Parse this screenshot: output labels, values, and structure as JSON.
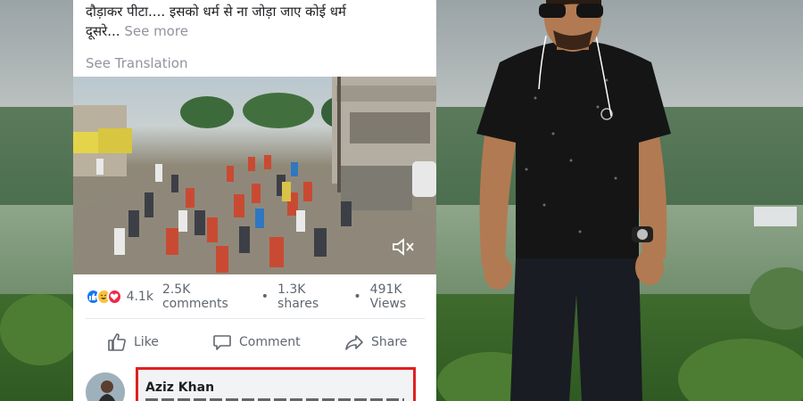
{
  "post": {
    "text_line1": "दौड़ाकर पीटा.... इसको धर्म से ना जोड़ा जाए कोई धर्म",
    "text_line2": "दूसरे...",
    "see_more": "See more",
    "see_translation": "See Translation"
  },
  "video": {
    "mute_icon": "speaker-muted-icon"
  },
  "stats": {
    "reaction_icons": [
      "like",
      "haha",
      "love"
    ],
    "reaction_count": "4.1k",
    "comments": "2.5K comments",
    "separator": "•",
    "shares": "1.3K shares",
    "views": "491K Views"
  },
  "actions": {
    "like": "Like",
    "comment": "Comment",
    "share": "Share"
  },
  "comment": {
    "author": "Aziz Khan",
    "highlight_color": "#e02020"
  },
  "colors": {
    "link_gray": "#90949c",
    "text": "#1c1e21",
    "like_blue": "#1877f2"
  }
}
